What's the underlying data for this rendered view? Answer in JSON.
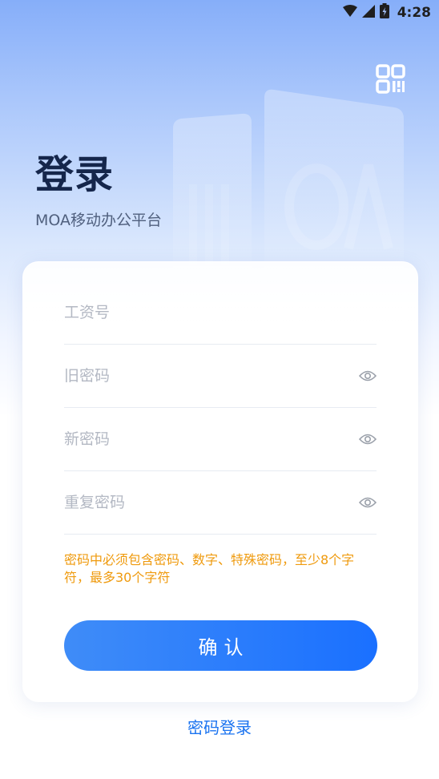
{
  "status_bar": {
    "time": "4:28",
    "icons": [
      "wifi-icon",
      "cellular-signal-icon",
      "battery-icon"
    ]
  },
  "header": {
    "title": "登录",
    "subtitle": "MOA移动办公平台",
    "scan_icon": "qr-code-scan-icon",
    "watermark_text": "MOA"
  },
  "form": {
    "employee_id": {
      "placeholder": "工资号",
      "value": ""
    },
    "old_password": {
      "placeholder": "旧密码",
      "value": "",
      "toggle_icon": "eye-icon"
    },
    "new_password": {
      "placeholder": "新密码",
      "value": "",
      "toggle_icon": "eye-icon"
    },
    "repeat_password": {
      "placeholder": "重复密码",
      "value": "",
      "toggle_icon": "eye-icon"
    },
    "hint": "密码中必须包含密码、数字、特殊密码，至少8个字符，最多30个字符",
    "confirm_label": "确认"
  },
  "footer": {
    "password_login_label": "密码登录"
  },
  "colors": {
    "primary": "#1a73f0",
    "title": "#15264b",
    "warning": "#ef9a0d",
    "background_top": "#86aef9"
  }
}
